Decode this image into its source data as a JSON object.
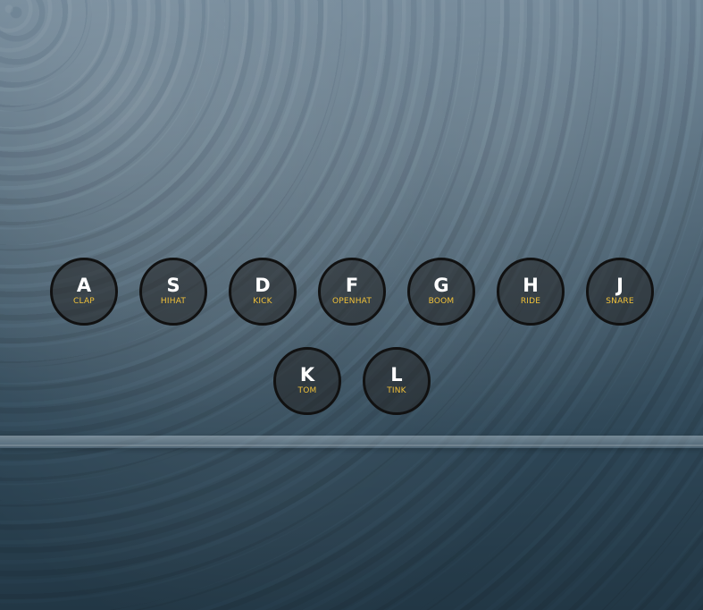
{
  "keys": [
    {
      "key": "A",
      "sound": "CLAP"
    },
    {
      "key": "S",
      "sound": "HIHAT"
    },
    {
      "key": "D",
      "sound": "KICK"
    },
    {
      "key": "F",
      "sound": "OPENHAT"
    },
    {
      "key": "G",
      "sound": "BOOM"
    },
    {
      "key": "H",
      "sound": "RIDE"
    },
    {
      "key": "J",
      "sound": "SNARE"
    },
    {
      "key": "K",
      "sound": "TOM"
    },
    {
      "key": "L",
      "sound": "TINK"
    }
  ]
}
